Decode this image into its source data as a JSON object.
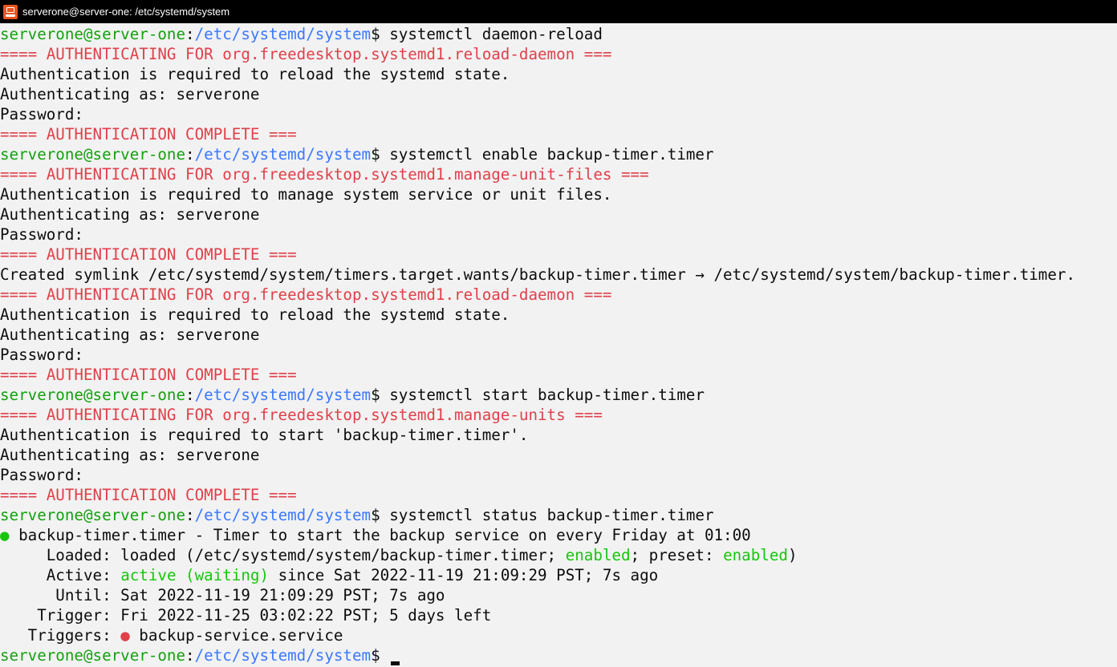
{
  "window": {
    "title": "serverone@server-one: /etc/systemd/system"
  },
  "colors": {
    "background": "#f2f2f2",
    "prompt_user": "#13a10e",
    "prompt_path": "#3b78ff",
    "auth_banner": "#e0404a",
    "status_green": "#16c60c",
    "text": "#0c0c0c"
  },
  "icons": {
    "app": "terminal-icon",
    "status_dot": "bullet-dot"
  },
  "lines": [
    [
      {
        "t": "serverone@server-one",
        "c": "user"
      },
      {
        "t": ":"
      },
      {
        "t": "/etc/systemd/system",
        "c": "path"
      },
      {
        "t": "$ systemctl daemon-reload"
      }
    ],
    [
      {
        "t": "==== AUTHENTICATING FOR org.freedesktop.systemd1.reload-daemon ===",
        "c": "red"
      }
    ],
    [
      {
        "t": "Authentication is required to reload the systemd state."
      }
    ],
    [
      {
        "t": "Authenticating as: serverone"
      }
    ],
    [
      {
        "t": "Password:"
      }
    ],
    [
      {
        "t": "==== AUTHENTICATION COMPLETE ===",
        "c": "red"
      }
    ],
    [
      {
        "t": "serverone@server-one",
        "c": "user"
      },
      {
        "t": ":"
      },
      {
        "t": "/etc/systemd/system",
        "c": "path"
      },
      {
        "t": "$ systemctl enable backup-timer.timer"
      }
    ],
    [
      {
        "t": "==== AUTHENTICATING FOR org.freedesktop.systemd1.manage-unit-files ===",
        "c": "red"
      }
    ],
    [
      {
        "t": "Authentication is required to manage system service or unit files."
      }
    ],
    [
      {
        "t": "Authenticating as: serverone"
      }
    ],
    [
      {
        "t": "Password:"
      }
    ],
    [
      {
        "t": "==== AUTHENTICATION COMPLETE ===",
        "c": "red"
      }
    ],
    [
      {
        "t": "Created symlink /etc/systemd/system/timers.target.wants/backup-timer.timer → /etc/systemd/system/backup-timer.timer."
      }
    ],
    [
      {
        "t": "==== AUTHENTICATING FOR org.freedesktop.systemd1.reload-daemon ===",
        "c": "red"
      }
    ],
    [
      {
        "t": "Authentication is required to reload the systemd state."
      }
    ],
    [
      {
        "t": "Authenticating as: serverone"
      }
    ],
    [
      {
        "t": "Password:"
      }
    ],
    [
      {
        "t": "==== AUTHENTICATION COMPLETE ===",
        "c": "red"
      }
    ],
    [
      {
        "t": "serverone@server-one",
        "c": "user"
      },
      {
        "t": ":"
      },
      {
        "t": "/etc/systemd/system",
        "c": "path"
      },
      {
        "t": "$ systemctl start backup-timer.timer"
      }
    ],
    [
      {
        "t": "==== AUTHENTICATING FOR org.freedesktop.systemd1.manage-units ===",
        "c": "red"
      }
    ],
    [
      {
        "t": "Authentication is required to start 'backup-timer.timer'."
      }
    ],
    [
      {
        "t": "Authenticating as: serverone"
      }
    ],
    [
      {
        "t": "Password:"
      }
    ],
    [
      {
        "t": "==== AUTHENTICATION COMPLETE ===",
        "c": "red"
      }
    ],
    [
      {
        "t": "serverone@server-one",
        "c": "user"
      },
      {
        "t": ":"
      },
      {
        "t": "/etc/systemd/system",
        "c": "path"
      },
      {
        "t": "$ systemctl status backup-timer.timer"
      }
    ],
    [
      {
        "t": "●",
        "c": "green"
      },
      {
        "t": " backup-timer.timer - Timer to start the backup service on every Friday at 01:00"
      }
    ],
    [
      {
        "t": "     Loaded: loaded (/etc/systemd/system/backup-timer.timer; "
      },
      {
        "t": "enabled",
        "c": "green"
      },
      {
        "t": "; preset: "
      },
      {
        "t": "enabled",
        "c": "green"
      },
      {
        "t": ")"
      }
    ],
    [
      {
        "t": "     Active: "
      },
      {
        "t": "active (waiting)",
        "c": "green"
      },
      {
        "t": " since Sat 2022-11-19 21:09:29 PST; 7s ago"
      }
    ],
    [
      {
        "t": "      Until: Sat 2022-11-19 21:09:29 PST; 7s ago"
      }
    ],
    [
      {
        "t": "    Trigger: Fri 2022-11-25 03:02:22 PST; 5 days left"
      }
    ],
    [
      {
        "t": "   Triggers: "
      },
      {
        "t": "●",
        "c": "red"
      },
      {
        "t": " backup-service.service"
      }
    ],
    [
      {
        "t": "serverone@server-one",
        "c": "user"
      },
      {
        "t": ":"
      },
      {
        "t": "/etc/systemd/system",
        "c": "path"
      },
      {
        "t": "$ "
      }
    ]
  ]
}
